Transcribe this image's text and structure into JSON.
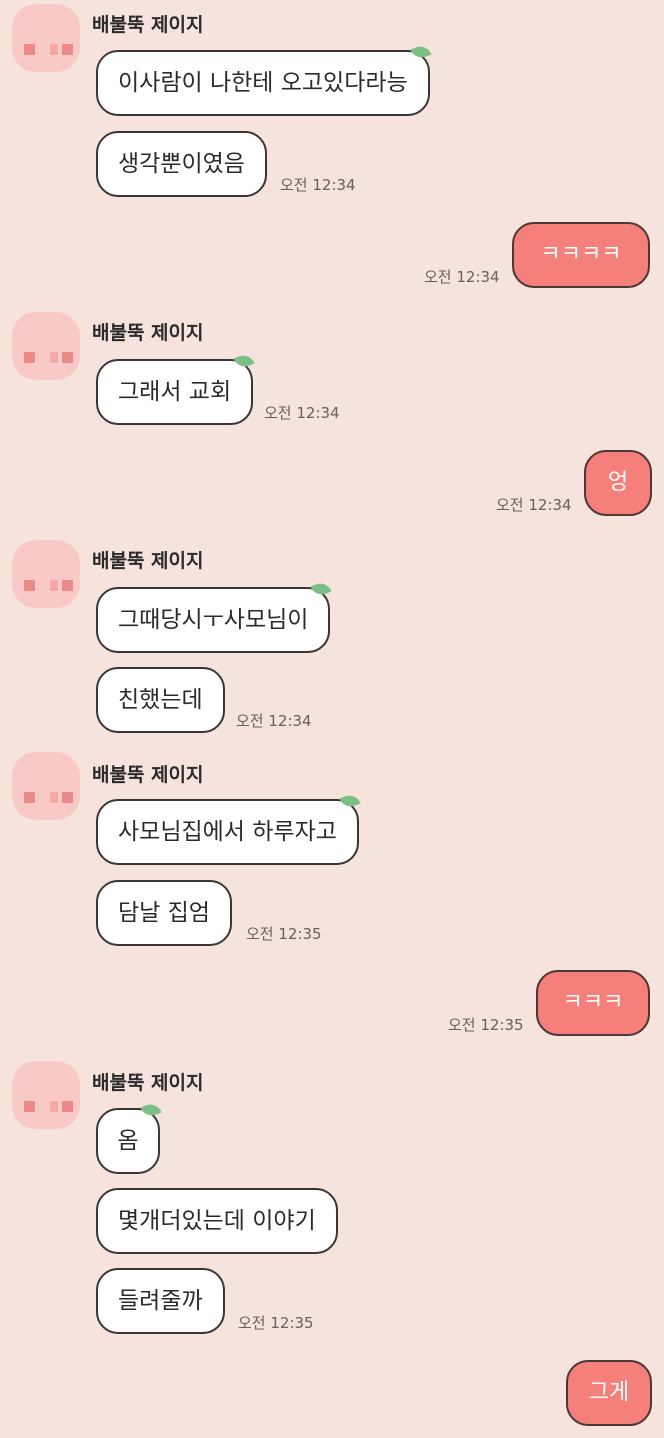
{
  "contact_name": "배불뚝 제이지",
  "messages": {
    "g1_b1": "이사람이 나한테 오고있다라능",
    "g1_b2": "생각뿐이였음",
    "g1_time": "오전 12:34",
    "m1": "ㅋㅋㅋㅋ",
    "m1_time": "오전 12:34",
    "g2_b1": "그래서 교회",
    "g2_time": "오전 12:34",
    "m2": "엉",
    "m2_time": "오전 12:34",
    "g3_b1": "그때당시ㅜ사모님이",
    "g3_b2": "친했는데",
    "g3_time": "오전 12:34",
    "g4_b1": "사모님집에서 하루자고",
    "g4_b2": "담날 집엄",
    "g4_time": "오전 12:35",
    "m3": "ㅋㅋㅋ",
    "m3_time": "오전 12:35",
    "g5_b1": "옴",
    "g5_b2": "몇개더있는데 이야기",
    "g5_b3": "들려줄까",
    "g5_time": "오전 12:35",
    "m4": "그게"
  },
  "colors": {
    "background": "#f5e3dc",
    "my_bubble": "#f47f7b",
    "their_bubble": "#ffffff",
    "avatar": "#f8c9c6"
  }
}
